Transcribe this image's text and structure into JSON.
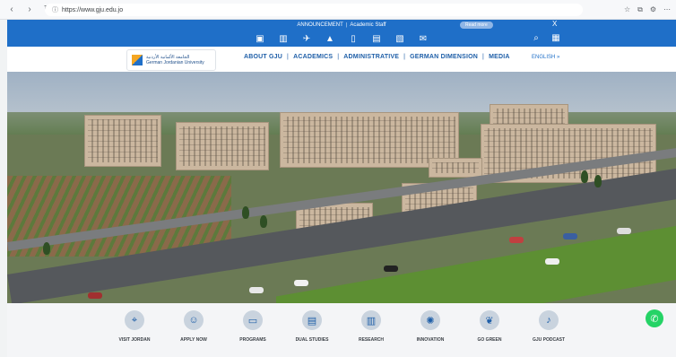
{
  "browser": {
    "url": "https://www.gju.edu.jo",
    "icons": [
      "back-icon",
      "forward-icon",
      "reload-icon",
      "info-icon"
    ]
  },
  "announcement": {
    "label": "ANNOUNCEMENT",
    "text": "Academic Staff",
    "read_more": "Read more",
    "close": "X"
  },
  "iconbar": {
    "icons": [
      "idcard-icon",
      "book-icon",
      "plane-icon",
      "triangle-icon",
      "door-icon",
      "chart-icon",
      "clipboard-icon",
      "mail-icon"
    ],
    "right_icons": [
      "search-icon",
      "calendar-icon"
    ]
  },
  "logo": {
    "text_ar": "الجامعة الألمانية الأردنية",
    "text_en": "German Jordanian University",
    "mark": "GJU"
  },
  "menu": {
    "items": [
      "ABOUT GJU",
      "ACADEMICS",
      "ADMINISTRATIVE",
      "GERMAN DIMENSION",
      "MEDIA"
    ],
    "language": "ENGLISH »"
  },
  "quick_links": [
    {
      "label": "VISIT JORDAN",
      "icon": "map-icon"
    },
    {
      "label": "APPLY NOW",
      "icon": "person-icon"
    },
    {
      "label": "PROGRAMS",
      "icon": "monitor-icon"
    },
    {
      "label": "DUAL STUDIES",
      "icon": "document-icon"
    },
    {
      "label": "RESEARCH",
      "icon": "research-icon"
    },
    {
      "label": "INNOVATION",
      "icon": "innovation-icon"
    },
    {
      "label": "GO GREEN",
      "icon": "leaf-icon"
    },
    {
      "label": "GJU PODCAST",
      "icon": "microphone-icon"
    }
  ],
  "colors": {
    "brand_blue": "#1f6fc8",
    "nav_text": "#1f5fa8",
    "whatsapp": "#25d366"
  }
}
